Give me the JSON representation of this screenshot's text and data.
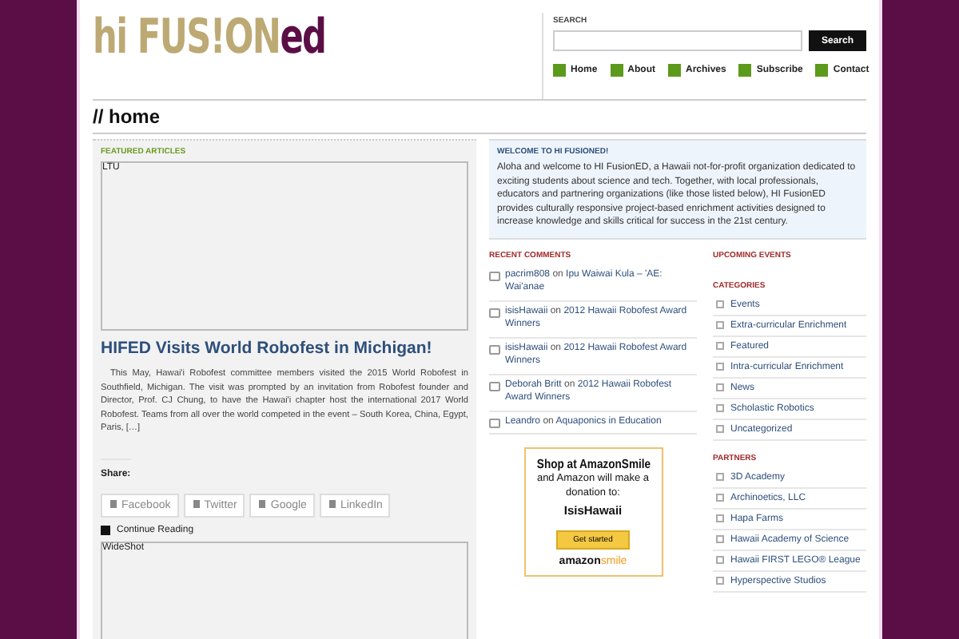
{
  "logo": {
    "part_1": "hi FUS!ON",
    "part_2": "ed"
  },
  "search": {
    "label": "SEARCH",
    "button": "Search"
  },
  "nav": [
    {
      "label": "Home"
    },
    {
      "label": "About"
    },
    {
      "label": "Archives"
    },
    {
      "label": "Subscribe"
    },
    {
      "label": "Contact"
    }
  ],
  "page_title": "// home",
  "featured": {
    "heading": "FEATURED ARTICLES",
    "image_alt": "LTU",
    "title": "HIFED Visits World Robofest in Michigan!",
    "excerpt": "This May, Hawai'i Robofest committee members visited the 2015 World Robofest in Southfield, Michigan. The visit was prompted by an invitation from Robofest founder and Director, Prof. CJ Chung, to have the Hawai'i chapter host the international 2017 World Robofest. Teams from all over the world competed in the event – South Korea, China, Egypt, Paris, […]",
    "share_label": "Share:",
    "share_buttons": [
      {
        "label": "Facebook"
      },
      {
        "label": "Twitter"
      },
      {
        "label": "Google"
      },
      {
        "label": "LinkedIn"
      }
    ],
    "continue": "Continue Reading",
    "image2_alt": "WideShot"
  },
  "welcome": {
    "heading": "WELCOME TO HI FUSIONED!",
    "text": "Aloha and welcome to HI FusionED, a Hawaii not-for-profit organization dedicated to exciting students about science and tech. Together, with local professionals, educators and partnering organizations (like those listed below), HI FusionED provides culturally responsive project-based enrichment activities designed to increase knowledge and skills critical for success in the 21st century."
  },
  "recent_comments": {
    "heading": "RECENT COMMENTS",
    "items": [
      {
        "author": "pacrim808",
        "joiner": "on",
        "post": "Ipu Waiwai Kula – 'AE: Wai'anae"
      },
      {
        "author": "isisHawaii",
        "joiner": "on",
        "post": "2012 Hawaii Robofest Award Winners"
      },
      {
        "author": "isisHawaii",
        "joiner": "on",
        "post": "2012 Hawaii Robofest Award Winners"
      },
      {
        "author": "Deborah Britt",
        "joiner": "on",
        "post": "2012 Hawaii Robofest Award Winners"
      },
      {
        "author": "Leandro",
        "joiner": "on",
        "post": "Aquaponics in Education"
      }
    ]
  },
  "amazon": {
    "line_1": "Shop at AmazonSmile",
    "line_2": "and Amazon will make a donation to:",
    "org": "IsisHawaii",
    "button": "Get started",
    "brand_1": "amazon",
    "brand_2": "smile"
  },
  "upcoming_events": {
    "heading": "UPCOMING EVENTS"
  },
  "categories": {
    "heading": "CATEGORIES",
    "items": [
      "Events",
      "Extra-curricular Enrichment",
      "Featured",
      "Intra-curricular Enrichment",
      "News",
      "Scholastic Robotics",
      "Uncategorized"
    ]
  },
  "partners": {
    "heading": "PARTNERS",
    "items": [
      "3D Academy",
      "Archinoetics, LLC",
      "Hapa Farms",
      "Hawaii Academy of Science",
      "Hawaii FIRST LEGO® League",
      "Hyperspective Studios"
    ]
  }
}
